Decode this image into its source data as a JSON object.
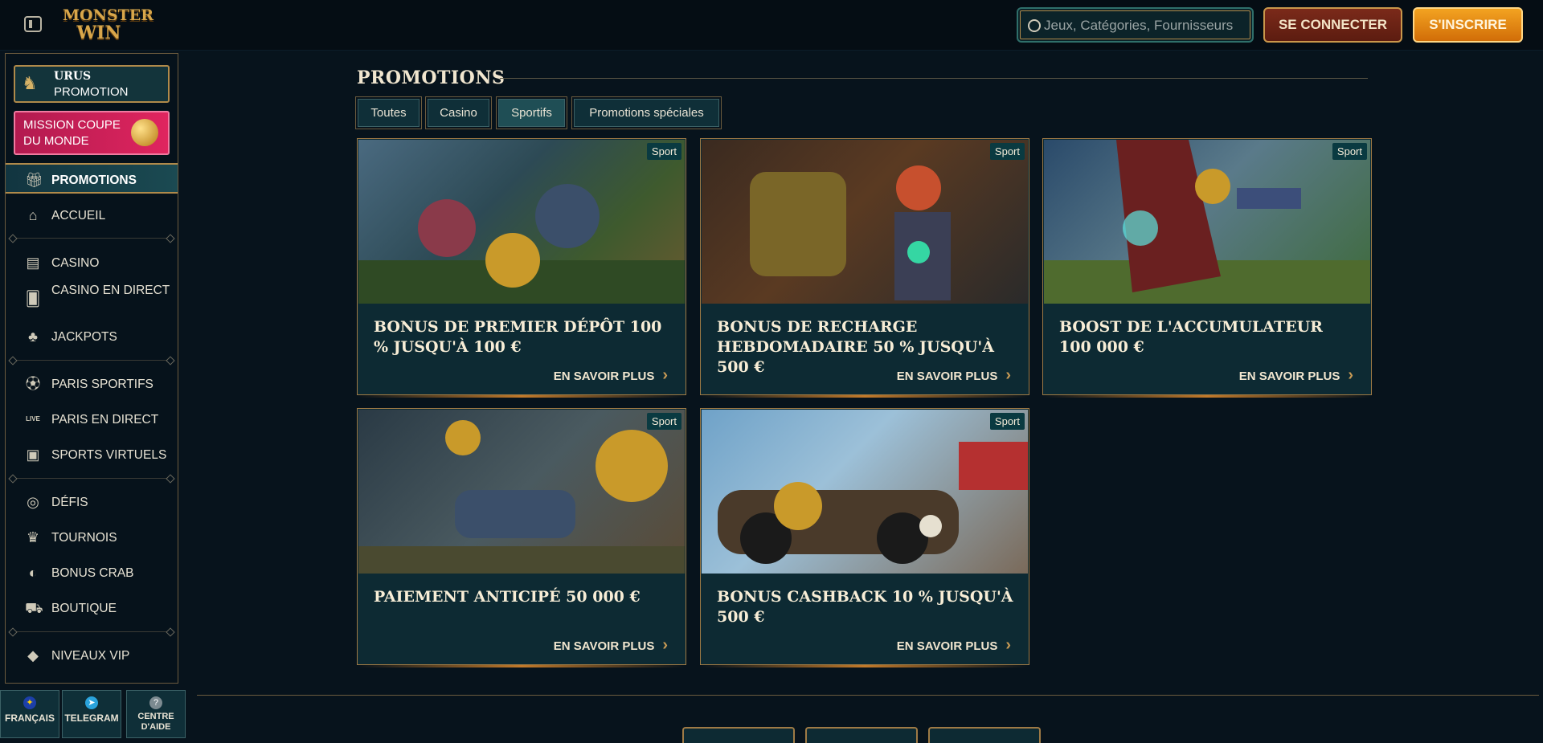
{
  "header": {
    "logo_line1": "MONSTER",
    "logo_line2": "WIN",
    "search_placeholder": "Jeux, Catégories, Fournisseurs",
    "login_label": "SE CONNECTER",
    "register_label": "S'INSCRIRE"
  },
  "sidebar": {
    "urus": {
      "title": "URUS",
      "subtitle": "PROMOTION"
    },
    "mission": {
      "label": "MISSION COUPE DU MONDE"
    },
    "items": [
      {
        "label": "PROMOTIONS",
        "icon": "gift-icon"
      },
      {
        "label": "ACCUEIL",
        "icon": "home-icon"
      },
      {
        "label": "CASINO",
        "icon": "slot-machine-icon"
      },
      {
        "label": "CASINO EN DIRECT",
        "icon": "card-icon"
      },
      {
        "label": "JACKPOTS",
        "icon": "clover-icon"
      },
      {
        "label": "PARIS SPORTIFS",
        "icon": "ball-icon"
      },
      {
        "label": "PARIS EN DIRECT",
        "icon": "live-icon"
      },
      {
        "label": "SPORTS VIRTUELS",
        "icon": "virtual-sports-icon"
      },
      {
        "label": "DÉFIS",
        "icon": "challenge-icon"
      },
      {
        "label": "TOURNOIS",
        "icon": "trophy-icon"
      },
      {
        "label": "BONUS CRAB",
        "icon": "crab-icon"
      },
      {
        "label": "BOUTIQUE",
        "icon": "shop-icon"
      },
      {
        "label": "NIVEAUX VIP",
        "icon": "diamond-icon"
      }
    ],
    "bottom": [
      {
        "label": "FRANÇAIS",
        "icon": "eu-flag-icon"
      },
      {
        "label": "TELEGRAM",
        "icon": "telegram-icon"
      },
      {
        "label": "CENTRE D'AIDE",
        "icon": "help-icon"
      }
    ]
  },
  "main": {
    "title": "PROMOTIONS",
    "filters": [
      "Toutes",
      "Casino",
      "Sportifs",
      "Promotions spéciales"
    ],
    "active_filter": "Sportifs",
    "cards": [
      {
        "badge": "Sport",
        "title": "BONUS DE PREMIER DÉPÔT 100 % JUSQU'À 100 €",
        "more": "EN SAVOIR PLUS"
      },
      {
        "badge": "Sport",
        "title": "BONUS DE RECHARGE HEBDOMADAIRE 50 % JUSQU'À 500 €",
        "more": "EN SAVOIR PLUS"
      },
      {
        "badge": "Sport",
        "title": "BOOST DE L'ACCUMULATEUR 100 000 €",
        "more": "EN SAVOIR PLUS"
      },
      {
        "badge": "Sport",
        "title": "PAIEMENT ANTICIPÉ 50 000 €",
        "more": "EN SAVOIR PLUS"
      },
      {
        "badge": "Sport",
        "title": "BONUS CASHBACK 10 % JUSQU'À 500 €",
        "more": "EN SAVOIR PLUS"
      }
    ]
  },
  "colors": {
    "accent_gold": "#b08a4a",
    "register_orange": "#f3a321",
    "login_red": "#7b2a1a",
    "mission_pink": "#e0255f"
  }
}
